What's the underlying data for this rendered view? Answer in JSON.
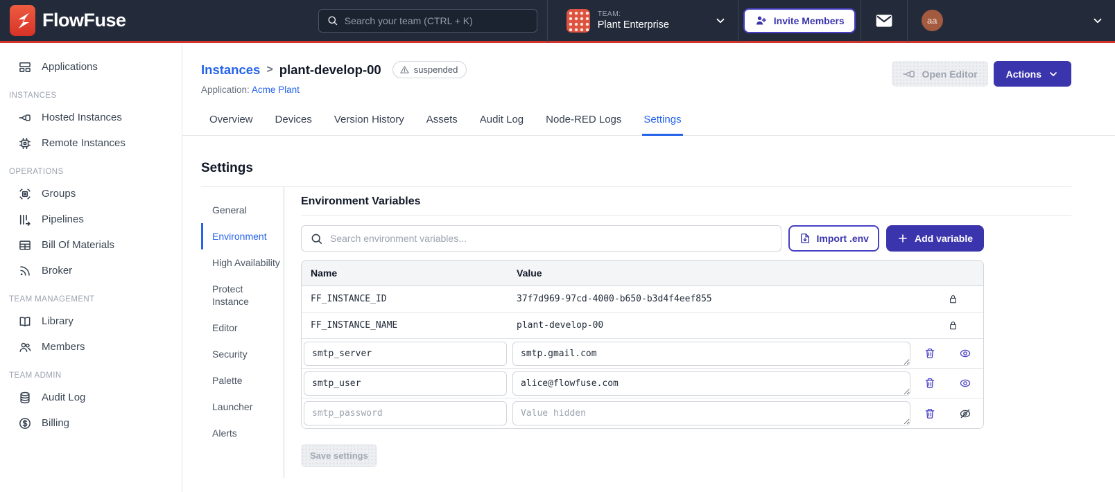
{
  "colors": {
    "navbar_bg": "#232B3B",
    "accent_red": "#D0342C",
    "indigo_primary": "#3B35AD",
    "indigo_icons": "#4740C4",
    "link_blue": "#2563EB",
    "border_gray": "#D1D5DB",
    "table_header_bg": "#F4F5F7"
  },
  "navbar": {
    "brand": "FlowFuse",
    "search_placeholder": "Search your team (CTRL + K)",
    "team_label": "TEAM:",
    "team_name": "Plant Enterprise",
    "invite_label": "Invite Members",
    "avatar_initials": "aa",
    "icons": [
      "flowfuse-logo-icon",
      "search-icon",
      "chevron-down-icon",
      "user-plus-icon",
      "mail-icon"
    ]
  },
  "sidebar": {
    "sections": [
      {
        "items": [
          {
            "label": "Applications",
            "icon": "applications-icon"
          }
        ]
      },
      {
        "header": "INSTANCES",
        "items": [
          {
            "label": "Hosted Instances",
            "icon": "hosted-instances-icon"
          },
          {
            "label": "Remote Instances",
            "icon": "remote-instances-icon"
          }
        ]
      },
      {
        "header": "OPERATIONS",
        "items": [
          {
            "label": "Groups",
            "icon": "groups-icon"
          },
          {
            "label": "Pipelines",
            "icon": "pipelines-icon"
          },
          {
            "label": "Bill Of Materials",
            "icon": "bill-of-materials-icon"
          },
          {
            "label": "Broker",
            "icon": "broker-icon"
          }
        ]
      },
      {
        "header": "TEAM MANAGEMENT",
        "items": [
          {
            "label": "Library",
            "icon": "library-icon"
          },
          {
            "label": "Members",
            "icon": "members-icon"
          }
        ]
      },
      {
        "header": "TEAM ADMIN",
        "items": [
          {
            "label": "Audit Log",
            "icon": "audit-log-icon"
          },
          {
            "label": "Billing",
            "icon": "billing-icon"
          }
        ]
      }
    ]
  },
  "header": {
    "breadcrumb": "Instances",
    "separator": ">",
    "instance_name": "plant-develop-00",
    "status_badge": "suspended",
    "application_label": "Application:",
    "application_name": "Acme Plant",
    "open_editor_label": "Open Editor",
    "actions_label": "Actions"
  },
  "tabs": [
    {
      "label": "Overview"
    },
    {
      "label": "Devices"
    },
    {
      "label": "Version History"
    },
    {
      "label": "Assets"
    },
    {
      "label": "Audit Log"
    },
    {
      "label": "Node-RED Logs"
    },
    {
      "label": "Settings",
      "active": true
    }
  ],
  "settings": {
    "title": "Settings",
    "nav": [
      {
        "label": "General"
      },
      {
        "label": "Environment",
        "active": true
      },
      {
        "label": "High Availability"
      },
      {
        "label": "Protect Instance"
      },
      {
        "label": "Editor"
      },
      {
        "label": "Security"
      },
      {
        "label": "Palette"
      },
      {
        "label": "Launcher"
      },
      {
        "label": "Alerts"
      }
    ],
    "section_title": "Environment Variables",
    "search_placeholder": "Search environment variables...",
    "import_button": "Import .env",
    "add_button": "Add variable",
    "save_button": "Save settings",
    "table": {
      "columns": [
        "Name",
        "Value"
      ],
      "locked_rows": [
        {
          "name": "FF_INSTANCE_ID",
          "value": "37f7d969-97cd-4000-b650-b3d4f4eef855",
          "icon": "lock-icon"
        },
        {
          "name": "FF_INSTANCE_NAME",
          "value": "plant-develop-00",
          "icon": "lock-icon"
        }
      ],
      "editable_rows": [
        {
          "name": "smtp_server",
          "value": "smtp.gmail.com",
          "icons": [
            "trash-icon",
            "eye-icon"
          ]
        },
        {
          "name": "smtp_user",
          "value": "alice@flowfuse.com",
          "icons": [
            "trash-icon",
            "eye-icon"
          ]
        },
        {
          "name": "smtp_password",
          "value": "",
          "value_placeholder": "Value hidden",
          "icons": [
            "trash-icon",
            "eye-off-icon"
          ]
        }
      ]
    }
  }
}
